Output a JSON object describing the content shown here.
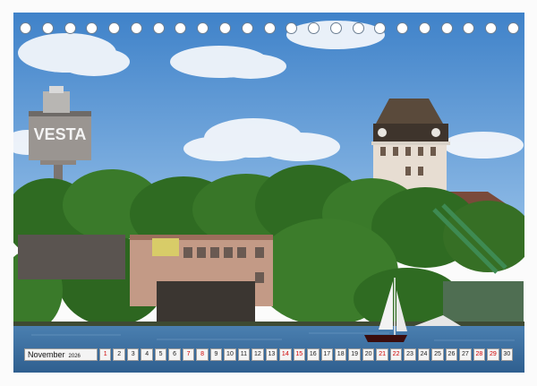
{
  "photo": {
    "description_icon": "landscape-photo",
    "colors": {
      "sky": "#4f8fd0",
      "trees": "#2f6b22",
      "water": "#3a6ea0"
    }
  },
  "tower_left": {
    "sign_text": "VESTA"
  },
  "calendar": {
    "month": "November",
    "year": "2026",
    "days": [
      {
        "d": "1",
        "weekend": true
      },
      {
        "d": "2",
        "weekend": false
      },
      {
        "d": "3",
        "weekend": false
      },
      {
        "d": "4",
        "weekend": false
      },
      {
        "d": "5",
        "weekend": false
      },
      {
        "d": "6",
        "weekend": false
      },
      {
        "d": "7",
        "weekend": true
      },
      {
        "d": "8",
        "weekend": true
      },
      {
        "d": "9",
        "weekend": false
      },
      {
        "d": "10",
        "weekend": false
      },
      {
        "d": "11",
        "weekend": false
      },
      {
        "d": "12",
        "weekend": false
      },
      {
        "d": "13",
        "weekend": false
      },
      {
        "d": "14",
        "weekend": true
      },
      {
        "d": "15",
        "weekend": true
      },
      {
        "d": "16",
        "weekend": false
      },
      {
        "d": "17",
        "weekend": false
      },
      {
        "d": "18",
        "weekend": false
      },
      {
        "d": "19",
        "weekend": false
      },
      {
        "d": "20",
        "weekend": false
      },
      {
        "d": "21",
        "weekend": true
      },
      {
        "d": "22",
        "weekend": true
      },
      {
        "d": "23",
        "weekend": false
      },
      {
        "d": "24",
        "weekend": false
      },
      {
        "d": "25",
        "weekend": false
      },
      {
        "d": "26",
        "weekend": false
      },
      {
        "d": "27",
        "weekend": false
      },
      {
        "d": "28",
        "weekend": true
      },
      {
        "d": "29",
        "weekend": true
      },
      {
        "d": "30",
        "weekend": false
      }
    ],
    "weekend_color": "#d00000"
  },
  "binding": {
    "hole_count": 23
  }
}
